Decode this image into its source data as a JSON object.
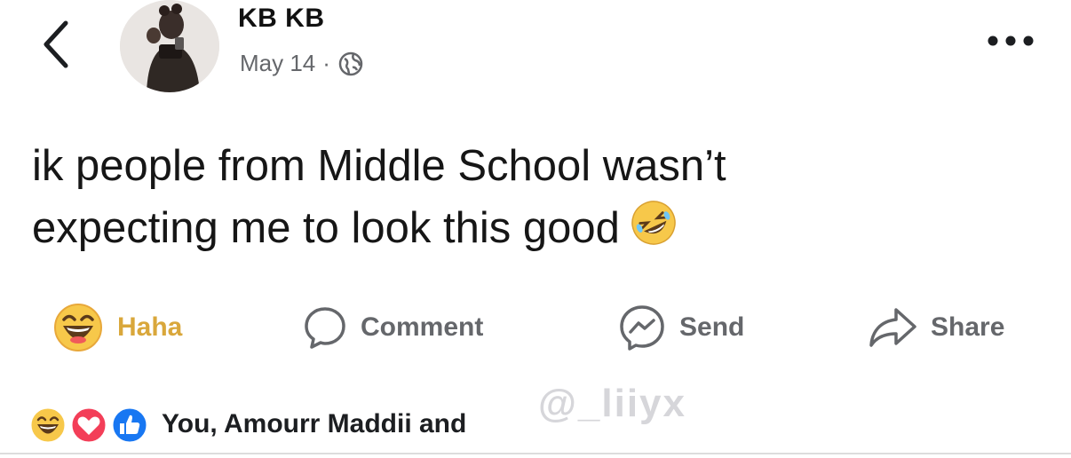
{
  "post": {
    "author": "KB KB",
    "date": "May 14",
    "separator": "·",
    "audience_icon": "globe-icon",
    "text_line1": "ik people from Middle School wasn’t",
    "text_line2": "expecting me to look this good",
    "inline_emoji": "rolling-on-floor-laughing-emoji"
  },
  "actions": {
    "haha_label": "Haha",
    "comment_label": "Comment",
    "send_label": "Send",
    "share_label": "Share"
  },
  "reactions": {
    "summary": "You, Amourr Maddii and",
    "icons": [
      "haha-reaction-icon",
      "love-reaction-icon",
      "like-reaction-icon"
    ]
  },
  "watermark": {
    "text": "@_liiyx"
  },
  "colors": {
    "haha_active": "#d9a73b",
    "secondary_text": "#65676b",
    "love": "#f33e58",
    "like": "#1877f2",
    "haha_face": "#f7c84a"
  }
}
